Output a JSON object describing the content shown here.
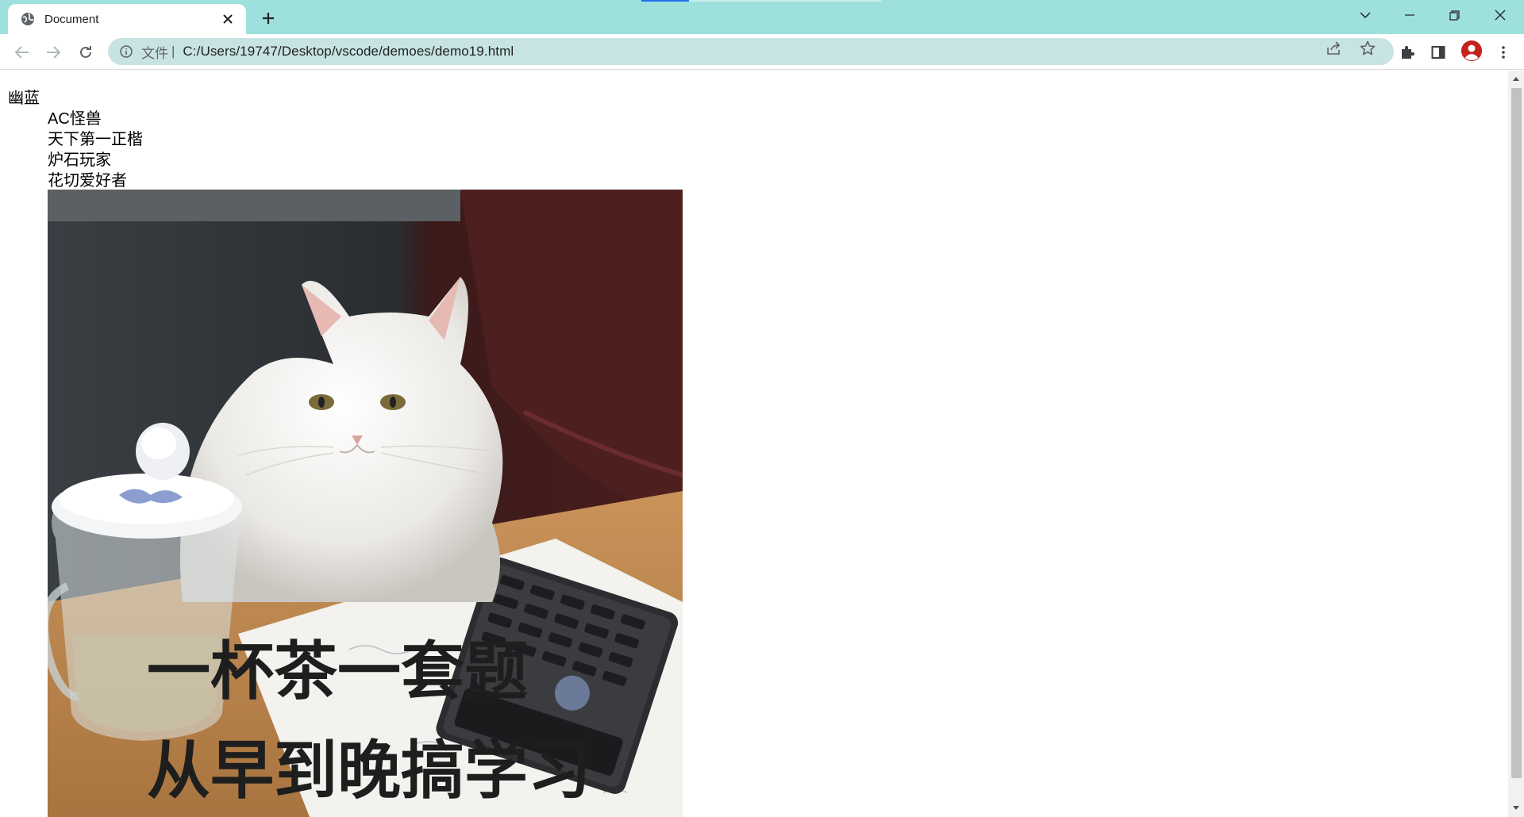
{
  "browser": {
    "tab": {
      "title": "Document",
      "icon": "globe-icon"
    },
    "omnibox": {
      "scheme_label": "文件",
      "separator": "|",
      "url": "C:/Users/19747/Desktop/vscode/demoes/demo19.html"
    },
    "colors": {
      "tab_strip": "#9ee0dc",
      "omnibox": "#c8e4e2",
      "avatar": "#c5221f"
    }
  },
  "page": {
    "heading": "幽蓝",
    "items": [
      "AC怪兽",
      "天下第一正楷",
      "炉石玩家",
      "花切爱好者"
    ],
    "image": {
      "caption_line1": "一杯茶一套题",
      "caption_line2": "从早到晚搞学习"
    }
  }
}
